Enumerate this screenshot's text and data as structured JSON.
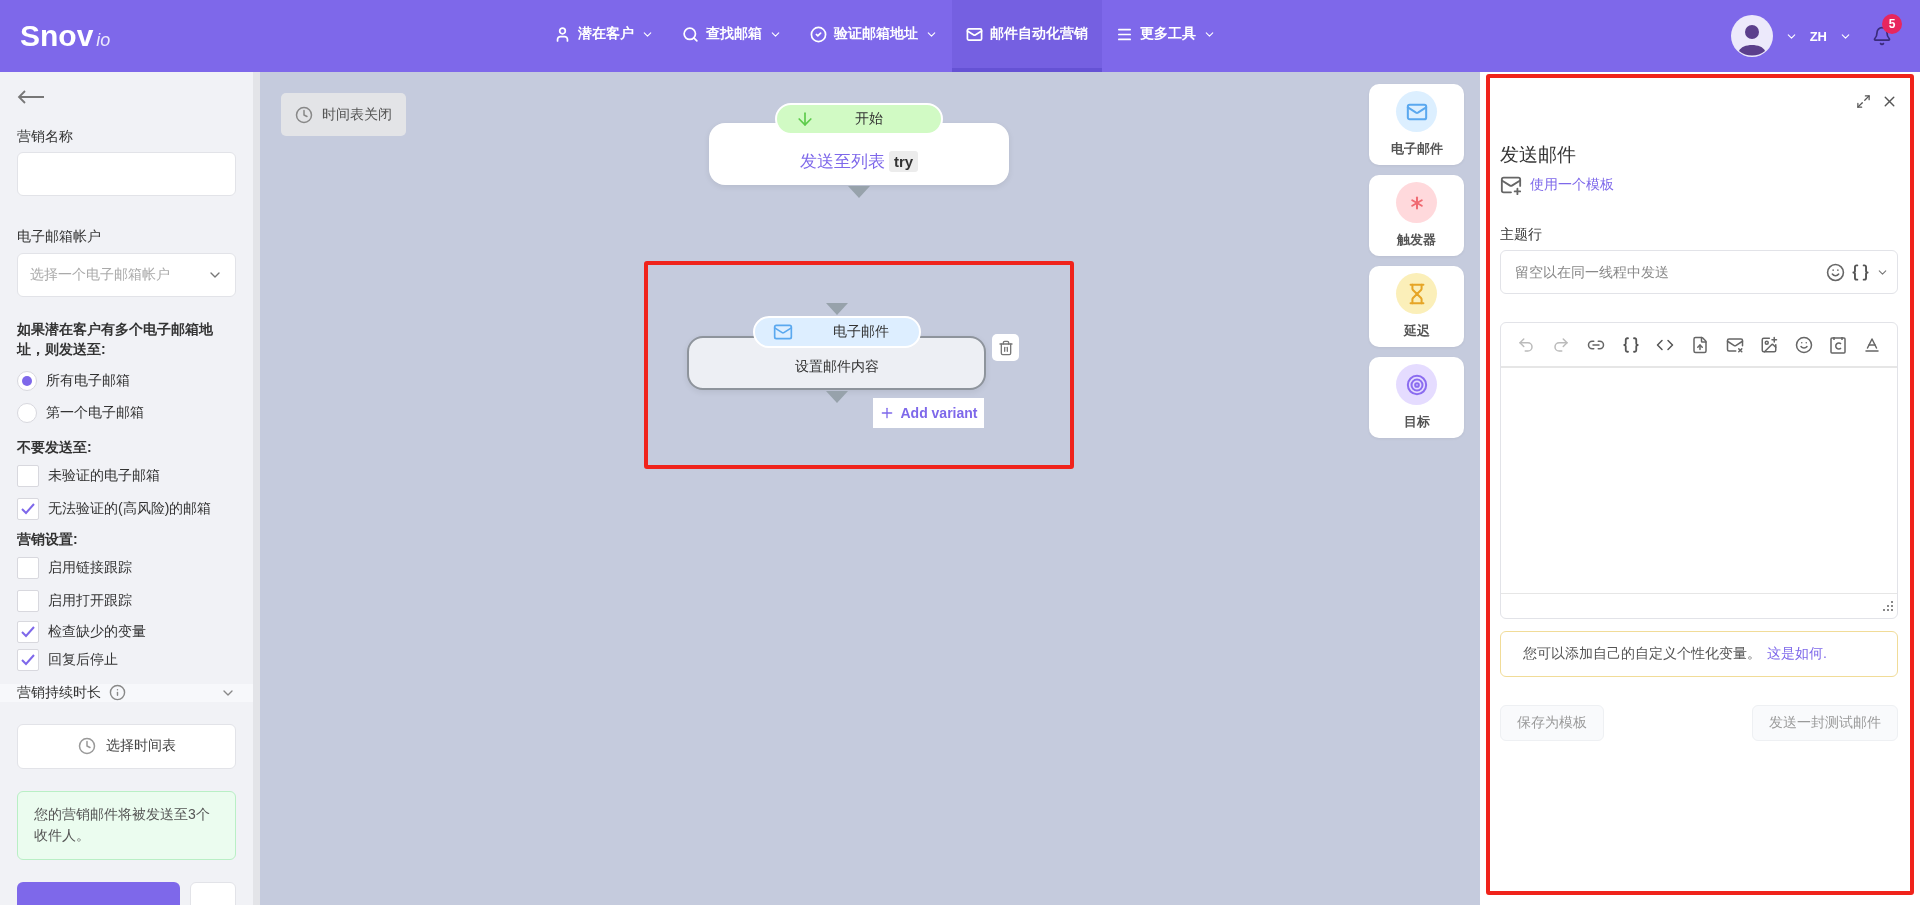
{
  "nav": {
    "logo": "Snov",
    "logo_suffix": "io",
    "items": [
      {
        "kind": "user",
        "label": "潜在客户",
        "has_menu": true,
        "selected": false
      },
      {
        "kind": "search",
        "label": "查找邮箱",
        "has_menu": true,
        "selected": false
      },
      {
        "kind": "verify",
        "label": "验证邮箱地址",
        "has_menu": true,
        "selected": false
      },
      {
        "kind": "mail",
        "label": "邮件自动化营销",
        "has_menu": false,
        "selected": true
      },
      {
        "kind": "menu",
        "label": "更多工具",
        "has_menu": true,
        "selected": false
      }
    ],
    "language": "ZH",
    "notifications": "5"
  },
  "sidebar": {
    "campaign_name": {
      "label": "营销名称"
    },
    "email_account": {
      "label": "电子邮箱帐户",
      "placeholder": "选择一个电子邮箱帐户"
    },
    "multi_email": {
      "label": "如果潜在客户有多个电子邮箱地址，则发送至:",
      "options": [
        {
          "label": "所有电子邮箱",
          "selected": true
        },
        {
          "label": "第一个电子邮箱",
          "selected": false
        }
      ]
    },
    "exclude": {
      "label": "不要发送至:",
      "options": [
        {
          "label": "未验证的电子邮箱",
          "checked": false
        },
        {
          "label": "无法验证的(高风险)的邮箱",
          "checked": true
        }
      ]
    },
    "settings": {
      "label": "营销设置:",
      "options": [
        {
          "label": "启用链接跟踪",
          "checked": false
        },
        {
          "label": "启用打开跟踪",
          "checked": false
        },
        {
          "label": "检查缺少的变量",
          "checked": true
        },
        {
          "label": "回复后停止",
          "checked": true
        }
      ]
    },
    "duration": {
      "label": "营销持续时长",
      "expanded": false
    },
    "schedule_button": "选择时间表",
    "notice": "您的营销邮件将被发送至3个收件人。"
  },
  "canvas": {
    "schedule_status": "时间表关闭",
    "flow": [
      {
        "kind": "start",
        "badge": "开始",
        "title": "发送至列表",
        "tag": "try",
        "selected": false
      },
      {
        "kind": "email",
        "badge": "电子邮件",
        "title": "设置邮件内容",
        "variant_button": "Add variant",
        "selected": true
      }
    ],
    "palette": [
      {
        "kind": "email",
        "label": "电子邮件"
      },
      {
        "kind": "trigger",
        "label": "触发器"
      },
      {
        "kind": "delay",
        "label": "延迟"
      },
      {
        "kind": "goal",
        "label": "目标"
      }
    ]
  },
  "panel": {
    "title": "发送邮件",
    "template_link": "使用一个模板",
    "subject_label": "主题行",
    "subject_placeholder": "留空以在同一线程中发送",
    "tip": "您可以添加自己的自定义个性化变量。",
    "tip_link": "这是如何.",
    "buttons": [
      {
        "label": "保存为模板",
        "disabled": true
      },
      {
        "label": "发送一封测试邮件",
        "disabled": true
      }
    ]
  }
}
